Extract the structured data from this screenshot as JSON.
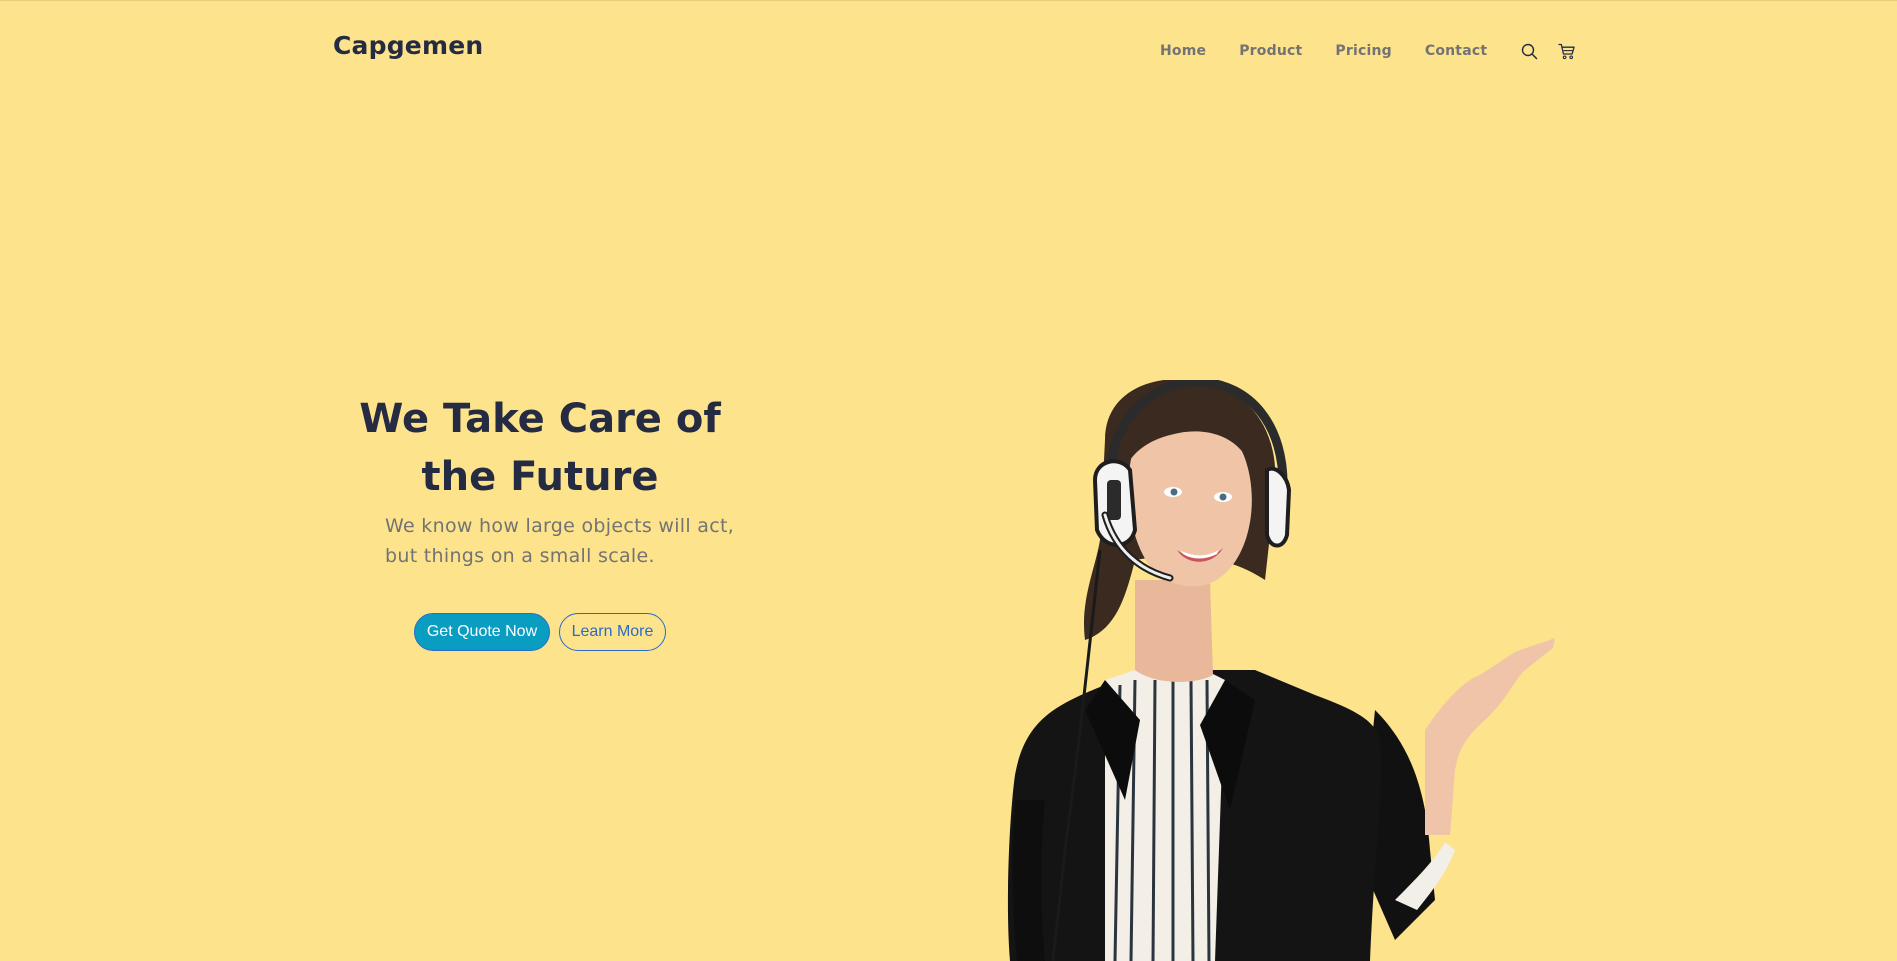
{
  "header": {
    "brand": "Capgemen",
    "nav": [
      {
        "label": "Home"
      },
      {
        "label": "Product"
      },
      {
        "label": "Pricing"
      },
      {
        "label": "Contact"
      }
    ],
    "icons": [
      "search-icon",
      "cart-icon"
    ]
  },
  "hero": {
    "title_line1": "We Take Care of",
    "title_line2": "the Future",
    "subtitle": "We know how large objects will act, but things on a small scale.",
    "primary_button": "Get Quote Now",
    "secondary_button": "Learn More",
    "image": "woman-with-headset"
  },
  "colors": {
    "background": "#FCE38C",
    "heading": "#252B42",
    "muted": "#737373",
    "primary": "#0A9DC2",
    "outline": "#2A6CC8"
  }
}
